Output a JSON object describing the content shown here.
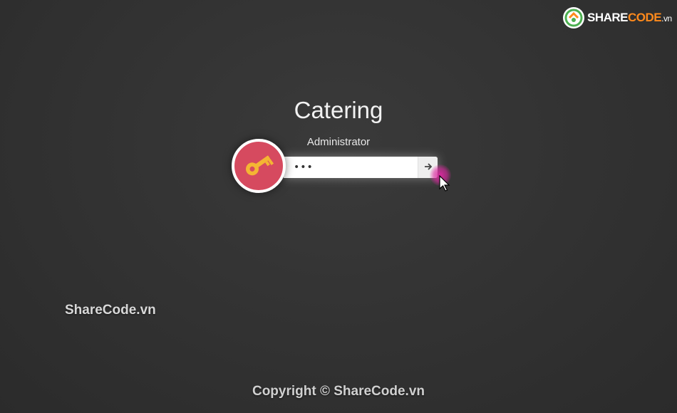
{
  "brand": {
    "logo_icon": "sharecode-logo-icon",
    "text_main": "SHARE",
    "text_highlight": "CODE",
    "text_suffix": ".vn"
  },
  "login": {
    "title": "Catering",
    "user_name": "Administrator",
    "avatar_icon": "key-icon",
    "password_value": "•••",
    "submit_icon": "arrow-right-icon"
  },
  "overlay": {
    "watermark": "ShareCode.vn",
    "copyright": "Copyright © ShareCode.vn"
  },
  "colors": {
    "background": "#333333",
    "avatar_bg": "#d64a5f",
    "key": "#f4b533",
    "brand_highlight": "#ff8a1c",
    "click_ring": "#dc28a0"
  }
}
